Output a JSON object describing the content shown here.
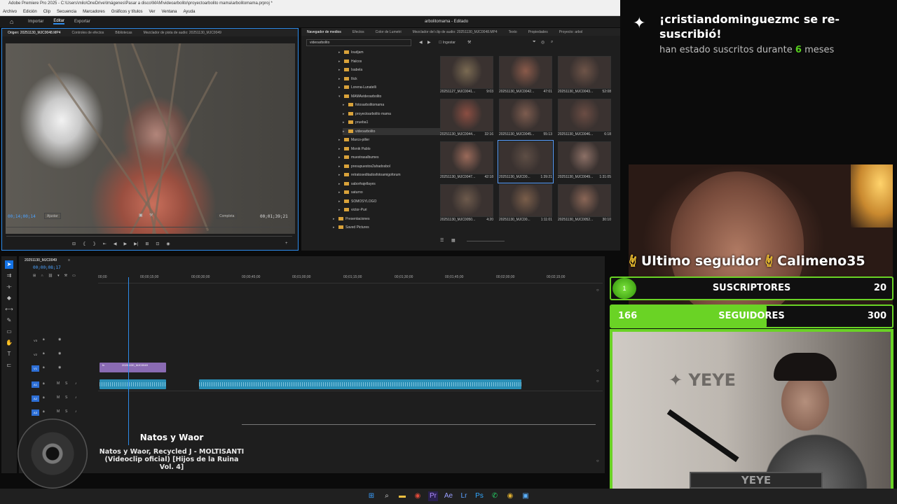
{
  "premiere": {
    "title_bar": "Adobe Premiere Pro 2025 - C:\\Users\\milo\\OneDrive\\Imágenes\\Pasar a disco\\MAM\\videoarbolito\\proyectoarbolito mama\\arbolitomama.prproj *",
    "menu": [
      "Archivo",
      "Edición",
      "Clip",
      "Secuencia",
      "Marcadores",
      "Gráficos y títulos",
      "Ver",
      "Ventana",
      "Ayuda"
    ],
    "workspaces": [
      "Importar",
      "Editar",
      "Exportar"
    ],
    "active_workspace": "Editar",
    "document_title": "arbolitomama - Editado",
    "source_tabs": [
      "Origen: 20251130_MJC0048.MP4",
      "Controles de efectos",
      "Bibliotecas",
      "Mezclador de pista de audio: 20251130_MJC0049"
    ],
    "source_timecode": "00;14;00;14",
    "source_fit": "Ajustar",
    "source_quality": "Completa",
    "source_duration": "00;01;39;21",
    "project_tabs": [
      "Navegador de medios",
      "Efectos",
      "Color de Lumetri",
      "Mezclador del clip de audio: 20251130_MJC0048.MP4",
      "Texto",
      "Propiedades",
      "Proyecto: arbol"
    ],
    "search_value": "videoarbolito",
    "ingest_label": "Ingestar",
    "folders": [
      {
        "name": "loudjam",
        "level": 0
      },
      {
        "name": "Halcos",
        "level": 0
      },
      {
        "name": "Isabela",
        "level": 0
      },
      {
        "name": "Ilick",
        "level": 0
      },
      {
        "name": "Lorena-Lunatelli",
        "level": 0
      },
      {
        "name": "MAMAvideoarbolito",
        "level": 0,
        "open": true
      },
      {
        "name": "fotosarbolitomama",
        "level": 1
      },
      {
        "name": "proyectoarbolito mama",
        "level": 1
      },
      {
        "name": "prueba1",
        "level": 1
      },
      {
        "name": "videoarbolito",
        "level": 1,
        "selected": true
      },
      {
        "name": "Marco-piller",
        "level": 0
      },
      {
        "name": "Monik Pablo",
        "level": 0
      },
      {
        "name": "muestrasalbumes",
        "level": 0
      },
      {
        "name": "presupuestos2ahadosbol",
        "level": 0
      },
      {
        "name": "retratoseditadosfotoamigoforum",
        "level": 0
      },
      {
        "name": "saborhajellayes",
        "level": 0
      },
      {
        "name": "saturno",
        "level": 0
      },
      {
        "name": "SOMOSYLOGO",
        "level": 0
      },
      {
        "name": "victor-Puri",
        "level": 0
      },
      {
        "name": "Presentaciones",
        "level": -1
      },
      {
        "name": "Saved Pictures",
        "level": -1
      }
    ],
    "thumbnails": [
      {
        "name": "20251127_MJC0041...",
        "dur": "9:03"
      },
      {
        "name": "20251130_MJC0042...",
        "dur": "47:01"
      },
      {
        "name": "20251130_MJC0043...",
        "dur": "52:08"
      },
      {
        "name": "20251130_MJC0044...",
        "dur": "32:16"
      },
      {
        "name": "20251130_MJC0045...",
        "dur": "55:13"
      },
      {
        "name": "20251130_MJC0046...",
        "dur": "6:18"
      },
      {
        "name": "20251130_MJC0047...",
        "dur": "42:18"
      },
      {
        "name": "20251130_MJC00...",
        "dur": "1:39:21",
        "selected": true
      },
      {
        "name": "20251130_MJC0049...",
        "dur": "1:31:05"
      },
      {
        "name": "20251130_MJC0050...",
        "dur": "4:20"
      },
      {
        "name": "20251130_MJC00...",
        "dur": "1:11:01"
      },
      {
        "name": "20251130_MJC0052...",
        "dur": "30:10"
      }
    ],
    "sequence_tab": "20251130_MJC0049",
    "sequence_timecode": "00;00;08;17",
    "ruler_labels": [
      "00;00",
      "00;00;15;00",
      "00;00;30;00",
      "00;00;45;00",
      "00;01;00;00",
      "00;01;15;00",
      "00;01;30;00",
      "00;01;45;00",
      "00;02;00;00",
      "00;02;15;00"
    ],
    "tracks": [
      "V3",
      "V2",
      "V1",
      "A1",
      "A2",
      "A3"
    ],
    "clip_label": "20251130_MJC0049",
    "clip_fx": "fx"
  },
  "now_playing": {
    "title": "Natos y Waor",
    "subtitle": "Natos y Waor, Recycled J - MOLTISANTI (Videoclip oficial) [Hijos de la Ruina Vol. 4]"
  },
  "alert": {
    "message": "¡cristiandominguezmc se re-suscribió!",
    "sub_before": "han estado suscritos durante",
    "months": "6",
    "sub_after": "meses",
    "accent": "#56d01d"
  },
  "overlay": {
    "last_follower_label": "Ultimo seguidor",
    "last_follower_name": "Calimeno35",
    "subs_label": "SUSCRIPTORES",
    "subs_goal": "20",
    "subs_current": "1",
    "followers_label": "SEGUIDORES",
    "followers_current": "166",
    "followers_goal": "300",
    "accent": "#6ad325",
    "webcam_brand": "YEYE"
  },
  "taskbar": {
    "icons": [
      "windows-icon",
      "search-icon",
      "file-explorer-icon",
      "chrome-icon",
      "premiere-icon",
      "media-encoder-icon",
      "lightroom-icon",
      "photoshop-icon",
      "whatsapp-icon",
      "chrome-alt-icon",
      "store-icon"
    ]
  }
}
